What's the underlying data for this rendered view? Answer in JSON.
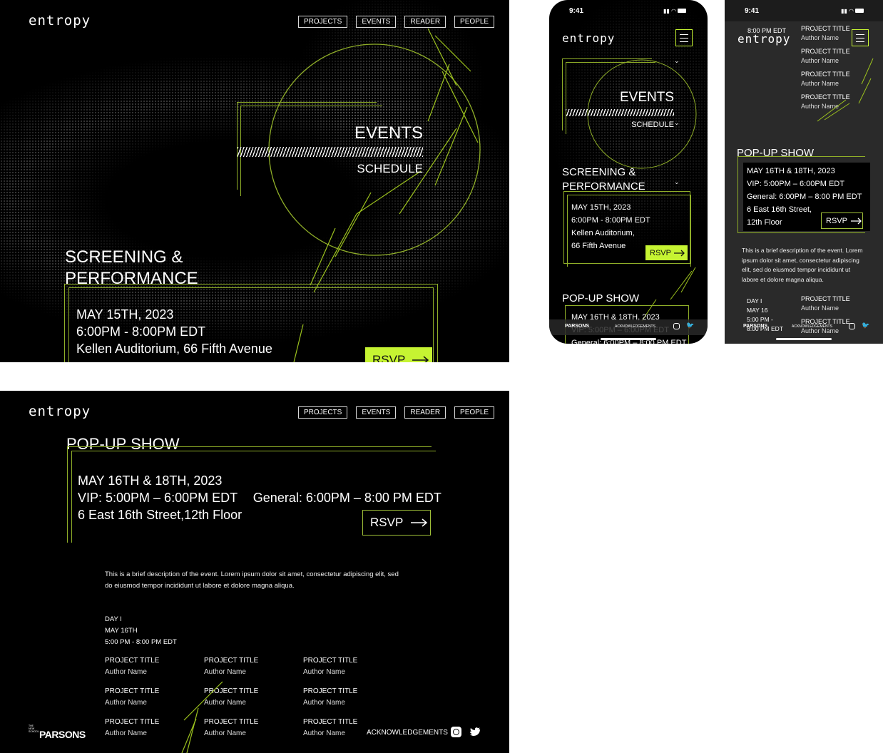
{
  "brand": {
    "logo": "entropy"
  },
  "nav": [
    "PROJECTS",
    "EVENTS",
    "READER",
    "PEOPLE"
  ],
  "events_hero": {
    "title": "EVENTS",
    "subtitle": "SCHEDULE"
  },
  "screening": {
    "title_line1": "SCREENING &",
    "title_line2": "PERFORMANCE",
    "date": "MAY 15TH, 2023",
    "time": "6:00PM - 8:00PM EDT",
    "location": "Kellen Auditorium, 66 Fifth Avenue",
    "rsvp": "RSVP",
    "mobile_location_1": "Kellen Auditorium,",
    "mobile_location_2": "66 Fifth Avenue"
  },
  "popup": {
    "title": "POP-UP SHOW",
    "date": "MAY 16TH & 18TH, 2023",
    "vip": "VIP: 5:00PM – 6:00PM EDT",
    "general": "General: 6:00PM – 8:00 PM EDT",
    "address": "6 East 16th Street,12th Floor",
    "address_1": "6 East 16th Street,",
    "address_2": "12th Floor",
    "rsvp": "RSVP",
    "description": "This is a brief description of the event. Lorem ipsum dolor sit amet, consectetur adipiscing elit, sed do eiusmod tempor incididunt ut labore et dolore magna aliqua.",
    "day_label": "DAY I",
    "day_date": "MAY 16TH",
    "day_time": "5:00 PM - 8:00 PM EDT",
    "mobile_day_date": "MAY 16",
    "mobile_day_time_1": "5:00 PM -",
    "mobile_day_time_2": "8:00 PM EDT",
    "mobile_top_time": "8:00 PM EDT"
  },
  "project": {
    "title": "PROJECT TITLE",
    "author": "Author Name"
  },
  "footer": {
    "parsons": "PARSONS",
    "newschool": "THE NEW SCHOOL",
    "acknowledgements": "ACKNOWLEDGEMENTS"
  },
  "phone": {
    "time": "9:41"
  },
  "icons": [
    "hamburger-icon",
    "arrow-right-icon",
    "instagram-icon",
    "twitter-icon",
    "chevron-down-icon",
    "battery-icon",
    "wifi-icon",
    "signal-icon"
  ],
  "colors": {
    "accent": "#c6f432",
    "background": "#000000",
    "phone_bg_dark": "#2a2a2a"
  }
}
